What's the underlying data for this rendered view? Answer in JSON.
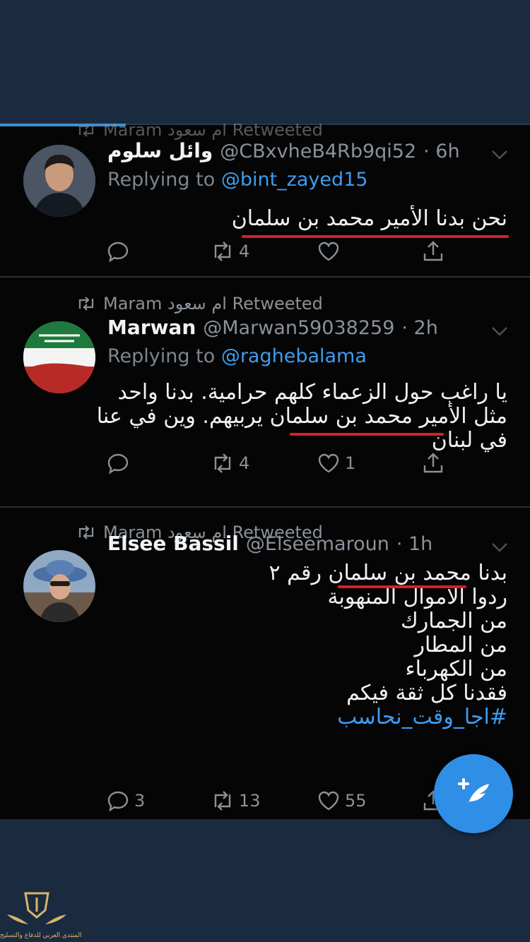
{
  "tweets": [
    {
      "retweeted_by": "Maram ام سعود Retweeted",
      "name": "وائل سلوم",
      "handle": "@CBxvheB4Rb9qi52",
      "time": "· 6h",
      "reply_prefix": "Replying to",
      "reply_to": "@bint_zayed15",
      "lines": [
        "نحن بدنا الأمير محمد بن سلمان"
      ],
      "replies": "",
      "retweets": "4",
      "likes": ""
    },
    {
      "retweeted_by": "Maram ام سعود Retweeted",
      "name": "Marwan",
      "handle": "@Marwan59038259",
      "time": "· 2h",
      "reply_prefix": "Replying to",
      "reply_to": "@raghebalama",
      "lines": [
        "يا راغب حول الزعماء كلهم حرامية. بدنا واحد",
        "مثل الأمير محمد بن سلمان يربيهم. وين في عنا",
        "في لبنان"
      ],
      "replies": "",
      "retweets": "4",
      "likes": "1"
    },
    {
      "retweeted_by": "Maram ام سعود Retweeted",
      "name": "Elsee Bassil",
      "handle": "@Elseemaroun",
      "time": "· 1h",
      "lines": [
        "بدنا محمد بن سلمان رقم ٢",
        "ردوا الاموال المنهوبة",
        "من الجمارك",
        "من المطار",
        "من الكهرباء",
        "فقدنا كل ثقة فيكم"
      ],
      "hashtag": "#اجا_وقت_نحاسب",
      "replies": "3",
      "retweets": "13",
      "likes": "55"
    }
  ],
  "watermark": "المنتدى العربي للدفاع والتسليح",
  "colors": {
    "accent": "#3e9cf0",
    "underline": "#d91f26",
    "fab": "#2f8fe6"
  },
  "icons": [
    "retweet-icon",
    "chevron-down-icon",
    "reply-icon",
    "heart-icon",
    "share-icon",
    "compose-tweet-icon"
  ]
}
